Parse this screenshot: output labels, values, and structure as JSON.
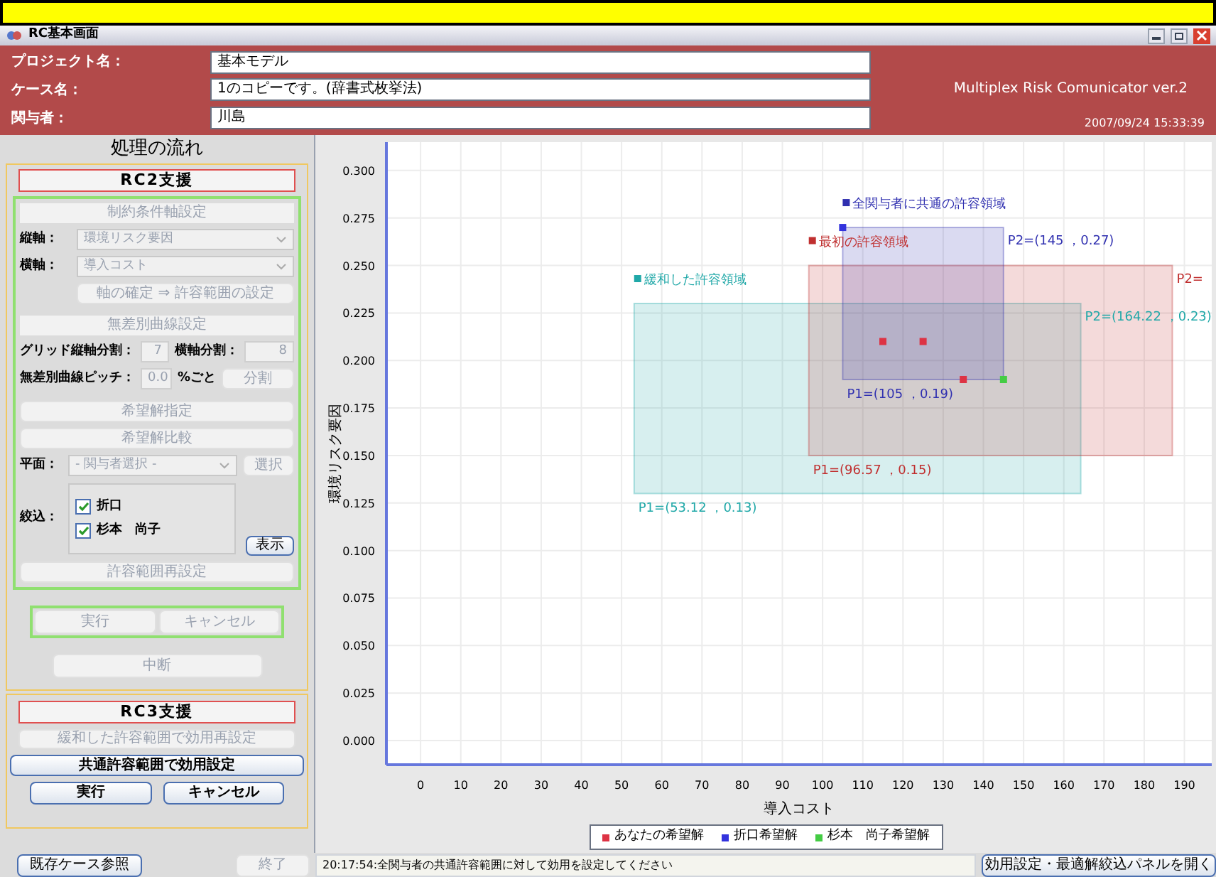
{
  "window": {
    "title": "RC基本画面"
  },
  "header": {
    "fields": [
      {
        "label": "プロジェクト名：",
        "value": "基本モデル"
      },
      {
        "label": "ケース名：",
        "value": "1のコピーです。(辞書式枚挙法)"
      },
      {
        "label": "関与者：",
        "value": "川島"
      }
    ],
    "app_name": "Multiplex Risk Comunicator ver.2",
    "timestamp": "2007/09/24 15:33:39"
  },
  "flow": {
    "title": "処理の流れ",
    "rc2": {
      "heading": "RC2支援",
      "axis_section": "制約条件軸設定",
      "axes": [
        {
          "label": "縦軸：",
          "value": "環境リスク要因"
        },
        {
          "label": "横軸：",
          "value": "導入コスト"
        }
      ],
      "axis_confirm": {
        "label": "軸の確定 ⇒ 許容範囲の設定",
        "disabled": true
      },
      "curve_section": "無差別曲線設定",
      "grid_v": {
        "label": "グリッド縦軸分割：",
        "value": "7"
      },
      "grid_h": {
        "label": "横軸分割：",
        "value": "8"
      },
      "pitch": {
        "label": "無差別曲線ピッチ：",
        "value": "0.0",
        "unit": "%ごと"
      },
      "split_button": {
        "label": "分割",
        "disabled": true
      },
      "hope_button": {
        "label": "希望解指定",
        "disabled": true
      },
      "compare_button": {
        "label": "希望解比較",
        "disabled": true
      },
      "plane": {
        "label": "平面：",
        "value": "- 関与者選択 -"
      },
      "select_button": {
        "label": "選択",
        "disabled": true
      },
      "filter_label": "絞込：",
      "participants": [
        {
          "name": "折口",
          "checked": true
        },
        {
          "name": "杉本　尚子",
          "checked": true
        }
      ],
      "show_button": {
        "label": "表示",
        "disabled": false
      },
      "reset_button": {
        "label": "許容範囲再設定",
        "disabled": true
      },
      "run_buttons": [
        {
          "label": "実行",
          "disabled": true
        },
        {
          "label": "キャンセル",
          "disabled": true
        }
      ],
      "stop_button": {
        "label": "中断",
        "disabled": true
      }
    },
    "rc3": {
      "heading": "RC3支援",
      "relaxed_button": {
        "label": "緩和した許容範囲で効用再設定",
        "disabled": true
      },
      "common_button": {
        "label": "共通許容範囲で効用設定",
        "disabled": false
      },
      "run_buttons": [
        {
          "label": "実行",
          "disabled": false
        },
        {
          "label": "キャンセル",
          "disabled": false
        }
      ]
    }
  },
  "chart": {
    "chart_data": {
      "type": "scatter",
      "xlabel": "導入コスト",
      "ylabel": "環境リスク要因",
      "xlim": [
        -8.5,
        196.8
      ],
      "ylim": [
        -0.0127,
        0.3149
      ],
      "xticks": [
        0,
        10,
        20,
        30,
        40,
        50,
        60,
        70,
        80,
        90,
        100,
        110,
        120,
        130,
        140,
        150,
        160,
        170,
        180,
        190
      ],
      "yticks": [
        {
          "value": 0,
          "label": "0.000"
        },
        {
          "value": 0.025,
          "label": "0.025"
        },
        {
          "value": 0.05,
          "label": "0.050"
        },
        {
          "value": 0.075,
          "label": "0.075"
        },
        {
          "value": 0.1,
          "label": "0.100"
        },
        {
          "value": 0.125,
          "label": "0.125"
        },
        {
          "value": 0.15,
          "label": "0.150"
        },
        {
          "value": 0.175,
          "label": "0.175"
        },
        {
          "value": 0.2,
          "label": "0.200"
        },
        {
          "value": 0.225,
          "label": "0.225"
        },
        {
          "value": 0.25,
          "label": "0.250"
        },
        {
          "value": 0.275,
          "label": "0.275"
        },
        {
          "value": 0.3,
          "label": "0.300"
        }
      ],
      "grid": true,
      "legend": "bottom",
      "series": [
        {
          "name": "緩和した許容領域",
          "type": "area",
          "color": "#20a8a8",
          "x": [
            53.12,
            164.22
          ],
          "values": [
            0.13,
            0.23
          ]
        },
        {
          "name": "最初の許容領域",
          "type": "area",
          "color": "#c03030",
          "x": [
            96.57,
            187
          ],
          "values": [
            0.15,
            0.25
          ]
        },
        {
          "name": "全関与者に共通の許容領域",
          "type": "area",
          "color": "#3030b0",
          "x": [
            105,
            145
          ],
          "values": [
            0.19,
            0.27
          ]
        },
        {
          "name": "あなたの希望解",
          "type": "scatter",
          "color": "#dd3344",
          "x": [
            115,
            125,
            135
          ],
          "values": [
            0.21,
            0.21,
            0.19
          ]
        },
        {
          "name": "折口希望解",
          "type": "scatter",
          "color": "#3333dd",
          "x": [
            105
          ],
          "values": [
            0.27
          ]
        },
        {
          "name": "杉本　尚子希望解",
          "type": "scatter",
          "color": "#44cc44",
          "x": [
            145
          ],
          "values": [
            0.19
          ]
        }
      ],
      "annotations": [
        {
          "text": "P2=(164.22 ，0.23)",
          "x": 164.22,
          "y": 0.23
        },
        {
          "text": "P1=(53.12 ，0.13)",
          "x": 53.12,
          "y": 0.13
        },
        {
          "text": "P2=",
          "x": 187,
          "y": 0.25
        },
        {
          "text": "P1=(96.57 ，0.15)",
          "x": 96.57,
          "y": 0.15
        },
        {
          "text": "P2=(145 ，0.27)",
          "x": 145,
          "y": 0.27
        },
        {
          "text": "P1=(105 ，0.19)",
          "x": 105,
          "y": 0.19
        }
      ]
    }
  },
  "footer": {
    "case_button": {
      "label": "既存ケース参照",
      "disabled": false
    },
    "exit_button": {
      "label": "終了",
      "disabled": true
    },
    "status": "20:17:54:全関与者の共通許容範囲に対して効用を設定してください",
    "panel_button": {
      "label": "効用設定・最適解絞込パネルを開く",
      "disabled": false
    }
  }
}
